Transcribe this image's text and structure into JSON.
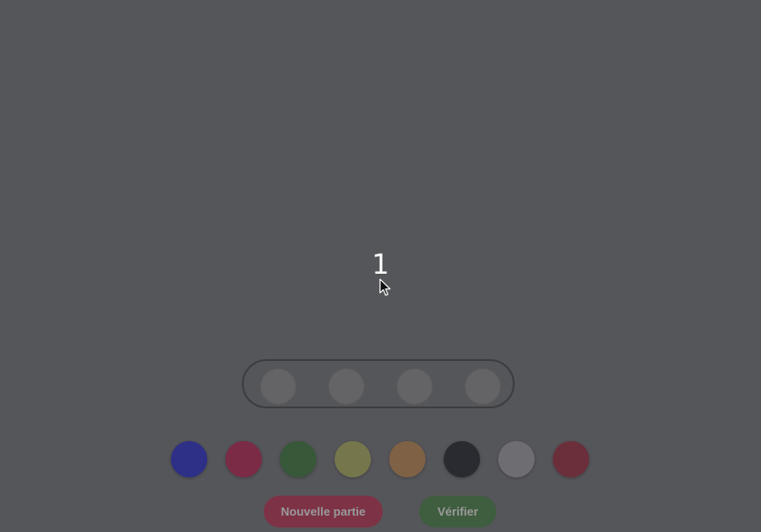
{
  "game": {
    "counter": "1"
  },
  "guess_row": {
    "slots": [
      {
        "color": "#646466"
      },
      {
        "color": "#646466"
      },
      {
        "color": "#646466"
      },
      {
        "color": "#646466"
      }
    ]
  },
  "palette": {
    "colors": [
      {
        "name": "blue",
        "hex": "#2e2f86"
      },
      {
        "name": "crimson",
        "hex": "#7b2b46"
      },
      {
        "name": "green",
        "hex": "#38583a"
      },
      {
        "name": "yellow",
        "hex": "#76764c"
      },
      {
        "name": "orange",
        "hex": "#7f6245"
      },
      {
        "name": "black",
        "hex": "#2a2b30"
      },
      {
        "name": "white",
        "hex": "#6e6e72"
      },
      {
        "name": "maroon",
        "hex": "#6b2f3c"
      }
    ]
  },
  "buttons": {
    "new_game_label": "Nouvelle partie",
    "check_label": "Vérifier"
  }
}
